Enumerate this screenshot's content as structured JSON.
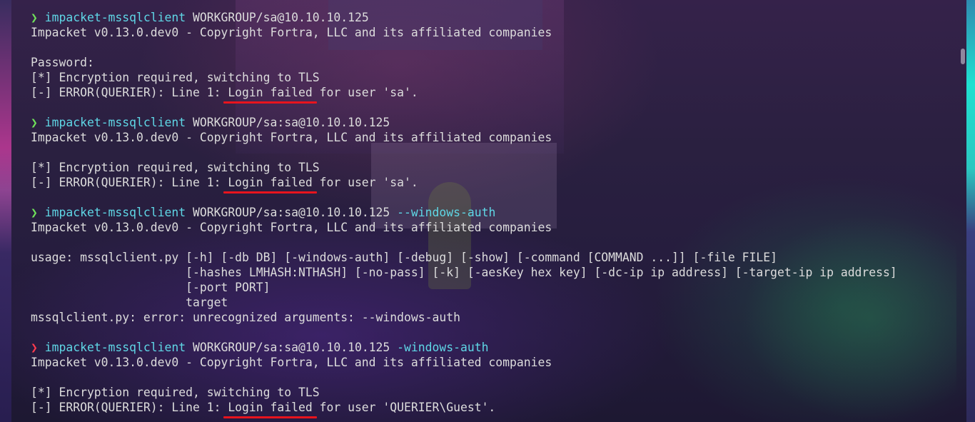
{
  "terminal": {
    "blocks": [
      {
        "prompt_symbol": "❯",
        "prompt_status": "ok",
        "command": "impacket-mssqlclient",
        "args": " WORKGROUP/sa@10.10.10.125",
        "option": "",
        "output": [
          "Impacket v0.13.0.dev0 - Copyright Fortra, LLC and its affiliated companies",
          "",
          "Password:",
          "[*] Encryption required, switching to TLS"
        ],
        "error_prefix": "[-] ERROR(QUERIER): Line 1: ",
        "error_highlight": "Login failed",
        "error_suffix": " for user 'sa'."
      },
      {
        "prompt_symbol": "❯",
        "prompt_status": "ok",
        "command": "impacket-mssqlclient",
        "args": " WORKGROUP/sa:sa@10.10.10.125",
        "option": "",
        "output": [
          "Impacket v0.13.0.dev0 - Copyright Fortra, LLC and its affiliated companies",
          "",
          "[*] Encryption required, switching to TLS"
        ],
        "error_prefix": "[-] ERROR(QUERIER): Line 1: ",
        "error_highlight": "Login failed",
        "error_suffix": " for user 'sa'."
      },
      {
        "prompt_symbol": "❯",
        "prompt_status": "ok",
        "command": "impacket-mssqlclient",
        "args": " WORKGROUP/sa:sa@10.10.10.125 ",
        "option": "--windows-auth",
        "output": [
          "Impacket v0.13.0.dev0 - Copyright Fortra, LLC and its affiliated companies",
          "",
          "usage: mssqlclient.py [-h] [-db DB] [-windows-auth] [-debug] [-show] [-command [COMMAND ...]] [-file FILE]",
          "                      [-hashes LMHASH:NTHASH] [-no-pass] [-k] [-aesKey hex key] [-dc-ip ip address] [-target-ip ip address]",
          "                      [-port PORT]",
          "                      target",
          "mssqlclient.py: error: unrecognized arguments: --windows-auth"
        ],
        "error_prefix": "",
        "error_highlight": "",
        "error_suffix": ""
      },
      {
        "prompt_symbol": "❯",
        "prompt_status": "error",
        "command": "impacket-mssqlclient",
        "args": " WORKGROUP/sa:sa@10.10.10.125 ",
        "option": "-windows-auth",
        "output": [
          "Impacket v0.13.0.dev0 - Copyright Fortra, LLC and its affiliated companies",
          "",
          "[*] Encryption required, switching to TLS"
        ],
        "error_prefix": "[-] ERROR(QUERIER): Line 1: ",
        "error_highlight": "Login failed",
        "error_suffix": " for user 'QUERIER\\Guest'."
      }
    ]
  },
  "colors": {
    "prompt_ok": "#6fe05a",
    "prompt_error": "#ff3b4e",
    "command": "#5fd7e6",
    "text": "#dcdcdc",
    "annotation_underline": "#e8141d"
  }
}
